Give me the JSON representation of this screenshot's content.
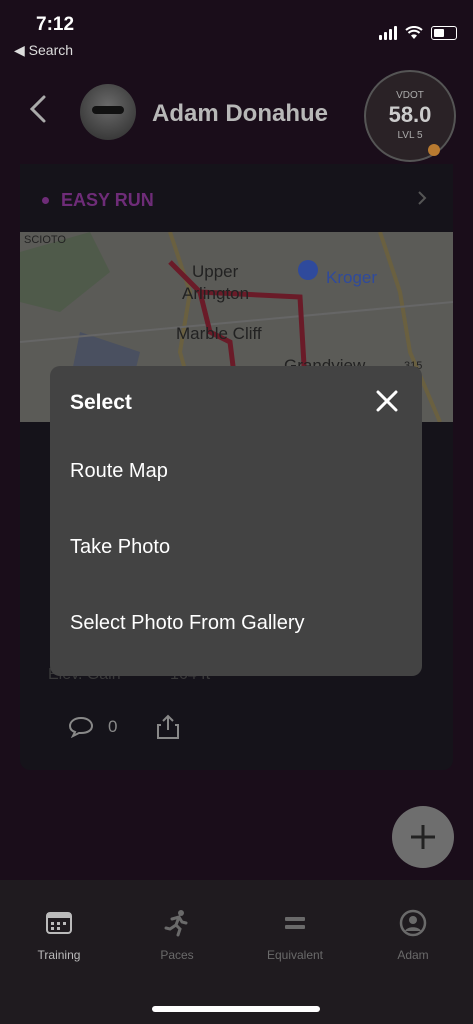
{
  "status": {
    "time": "7:12",
    "back_label": "◀ Search"
  },
  "header": {
    "user_name": "Adam Donahue",
    "vdot_label": "VDOT",
    "vdot_value": "58.0",
    "level": "LVL 5"
  },
  "card": {
    "run_type": "EASY RUN",
    "map_labels": [
      "Upper",
      "Arlington",
      "Marble Cliff",
      "Grandview",
      "Kroger",
      "SCIOTO",
      "315"
    ],
    "elev_label": "Elev. Gain",
    "elev_value": "164 ft",
    "comments": "0"
  },
  "modal": {
    "title": "Select",
    "options": [
      "Route Map",
      "Take Photo",
      "Select Photo From Gallery"
    ]
  },
  "tabs": [
    {
      "label": "Training",
      "icon": "calendar-icon"
    },
    {
      "label": "Paces",
      "icon": "runner-icon"
    },
    {
      "label": "Equivalent",
      "icon": "equals-icon"
    },
    {
      "label": "Adam",
      "icon": "profile-icon"
    }
  ]
}
